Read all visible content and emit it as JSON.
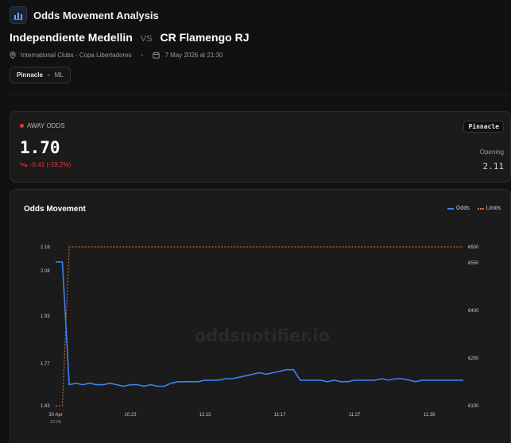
{
  "header": {
    "title": "Odds Movement Analysis",
    "home_team": "Independiente Medellin",
    "vs": "VS",
    "away_team": "CR Flamengo RJ",
    "competition": "International Clubs - Copa Libertadores",
    "datetime": "7 May 2026 at 21:30",
    "bookmaker_chip": "Pinnacle",
    "market_chip": "ML"
  },
  "odds_card": {
    "label": "AWAY ODDS",
    "value": "1.70",
    "change": "-0.41 (-19.2%)",
    "bookmaker": "Pinnacle",
    "opening_label": "Opening",
    "opening_value": "2.11"
  },
  "chart_card": {
    "title": "Odds Movement",
    "legend_odds": "Odds",
    "legend_limits": "Limits",
    "watermark": "oddsnotifier.io"
  },
  "colors": {
    "odds_line": "#3b82f6",
    "limits_line": "#e07b39",
    "negative": "#e53935"
  },
  "chart_data": {
    "type": "line",
    "x_ticks": [
      {
        "idx": 0,
        "label": "30 Apr",
        "sub": "23:08"
      },
      {
        "idx": 11,
        "label": "10:23"
      },
      {
        "idx": 22,
        "label": "11:13"
      },
      {
        "idx": 33,
        "label": "11:17"
      },
      {
        "idx": 44,
        "label": "11:27"
      },
      {
        "idx": 55,
        "label": "11:39"
      }
    ],
    "y_left_ticks": [
      "2.16",
      "2.08",
      "1.93",
      "1.77",
      "1.63"
    ],
    "y_left_values": [
      2.16,
      2.08,
      1.93,
      1.77,
      1.63
    ],
    "ylim_left": [
      1.63,
      2.16
    ],
    "y_right_ticks": [
      "€600",
      "€550",
      "€400",
      "€250",
      "€100"
    ],
    "y_right_values": [
      600,
      550,
      400,
      250,
      100
    ],
    "ylim_right": [
      100,
      600
    ],
    "series": [
      {
        "name": "Odds",
        "axis": "left",
        "values": [
          2.11,
          2.11,
          1.7,
          1.705,
          1.7,
          1.705,
          1.7,
          1.7,
          1.705,
          1.7,
          1.695,
          1.7,
          1.7,
          1.695,
          1.7,
          1.695,
          1.695,
          1.705,
          1.71,
          1.71,
          1.71,
          1.71,
          1.715,
          1.715,
          1.715,
          1.72,
          1.72,
          1.725,
          1.73,
          1.735,
          1.74,
          1.735,
          1.74,
          1.745,
          1.75,
          1.75,
          1.715,
          1.715,
          1.715,
          1.715,
          1.71,
          1.715,
          1.71,
          1.71,
          1.715,
          1.715,
          1.715,
          1.715,
          1.72,
          1.715,
          1.72,
          1.72,
          1.715,
          1.71,
          1.715,
          1.715,
          1.715,
          1.715,
          1.715,
          1.715,
          1.715
        ]
      },
      {
        "name": "Limits",
        "axis": "right",
        "values": [
          100,
          100,
          600,
          600,
          600,
          600,
          600,
          600,
          600,
          600,
          600,
          600,
          600,
          600,
          600,
          600,
          600,
          600,
          600,
          600,
          600,
          600,
          600,
          600,
          600,
          600,
          600,
          600,
          600,
          600,
          600,
          600,
          600,
          600,
          600,
          600,
          600,
          600,
          600,
          600,
          600,
          600,
          600,
          600,
          600,
          600,
          600,
          600,
          600,
          600,
          600,
          600,
          600,
          600,
          600,
          600,
          600,
          600,
          600,
          600,
          600
        ]
      }
    ]
  }
}
